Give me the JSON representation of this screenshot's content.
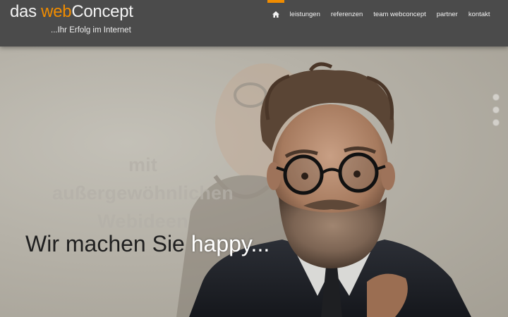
{
  "logo": {
    "part1": "das ",
    "part2": "web",
    "part3": "Concept",
    "tagline": "...Ihr Erfolg im Internet"
  },
  "nav": {
    "home_icon": "home-icon",
    "items": [
      "leistungen",
      "referenzen",
      "team webconcept",
      "partner",
      "kontakt"
    ]
  },
  "hero": {
    "subtitle_line1": "mit außergewöhnlichen",
    "subtitle_line2": "Webideen",
    "headline_part1": "Wir machen Sie ",
    "headline_part2": "happy..."
  },
  "slider": {
    "dot_count": 3
  },
  "colors": {
    "header_bg": "#4b4b4b",
    "accent": "#f08c00",
    "background": "#b9b5ad"
  }
}
